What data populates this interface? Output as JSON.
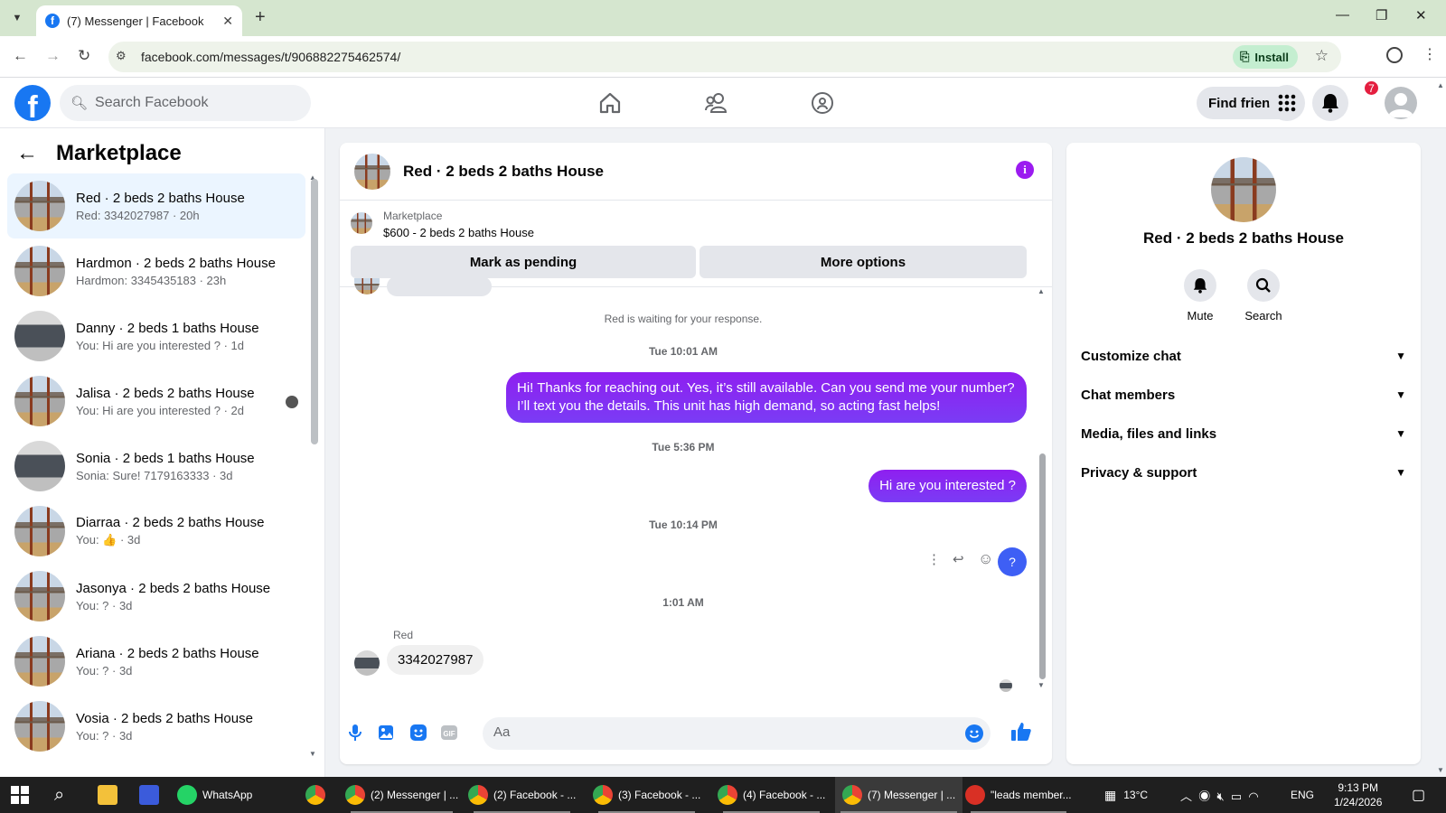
{
  "browser": {
    "tab_title": "(7) Messenger | Facebook",
    "url": "facebook.com/messages/t/906882275462574/",
    "install_label": "Install"
  },
  "fb": {
    "search_placeholder": "Search Facebook",
    "find_friends": "Find friends",
    "notif_count": "7"
  },
  "sidebar": {
    "title": "Marketplace",
    "conversations": [
      {
        "name": "Red · 2 beds 2 baths House",
        "snippet": "Red: 3342027987 · 20h",
        "thumb": "house-tan"
      },
      {
        "name": "Hardmon · 2 beds 2 baths House",
        "snippet": "Hardmon: 3345435183 · 23h",
        "thumb": "house-tan"
      },
      {
        "name": "Danny · 2 beds 1 baths House",
        "snippet": "You: Hi are you interested ? · 1d",
        "thumb": "house-gray"
      },
      {
        "name": "Jalisa · 2 beds 2 baths House",
        "snippet": "You: Hi are you interested ? · 2d",
        "thumb": "house-tan"
      },
      {
        "name": "Sonia · 2 beds 1 baths House",
        "snippet": "Sonia: Sure! 7179163333 · 3d",
        "thumb": "house-gray"
      },
      {
        "name": "Diarraa · 2 beds 2 baths House",
        "snippet": "You: 👍 · 3d",
        "thumb": "house-tan"
      },
      {
        "name": "Jasonya · 2 beds 2 baths House",
        "snippet": "You: ? · 3d",
        "thumb": "house-tan"
      },
      {
        "name": "Ariana · 2 beds 2 baths House",
        "snippet": "You: ? · 3d",
        "thumb": "house-tan"
      },
      {
        "name": "Vosia · 2 beds 2 baths House",
        "snippet": "You: ? · 3d",
        "thumb": "house-tan"
      }
    ]
  },
  "chat": {
    "title": "Red · 2 beds 2 baths House",
    "marketplace_label": "Marketplace",
    "listing": "$600 - 2 beds 2 baths House",
    "mark_pending": "Mark as pending",
    "more_options": "More options",
    "waiting": "Red is waiting for your response.",
    "ts1": "Tue 10:01 AM",
    "msg1": "Hi! Thanks for reaching out. Yes, it’s still available. Can you send me your number? I’ll text you the details. This unit has high demand, so acting fast helps!",
    "ts2": "Tue 5:36 PM",
    "msg2": "Hi are you interested ?",
    "ts3": "Tue 10:14 PM",
    "msg3": "?",
    "ts4": "1:01 AM",
    "sender": "Red",
    "reply": "3342027987",
    "composer_placeholder": "Aa"
  },
  "panel": {
    "title": "Red · 2 beds 2 baths House",
    "mute": "Mute",
    "search": "Search",
    "rows": [
      "Customize chat",
      "Chat members",
      "Media, files and links",
      "Privacy & support"
    ]
  },
  "taskbar": {
    "items": [
      "WhatsApp",
      "(2) Messenger | ...",
      "(2) Facebook - ...",
      "(3) Facebook - ...",
      "(4) Facebook - ...",
      "(7) Messenger | ...",
      "\"leads member..."
    ],
    "temp": "13°C",
    "lang": "ENG",
    "time": "9:13 PM",
    "date": "1/24/2026"
  },
  "colors": {
    "fb_blue": "#1877f2",
    "messenger_purple": "#8a18f5",
    "browser_green": "#d5e6cf"
  }
}
